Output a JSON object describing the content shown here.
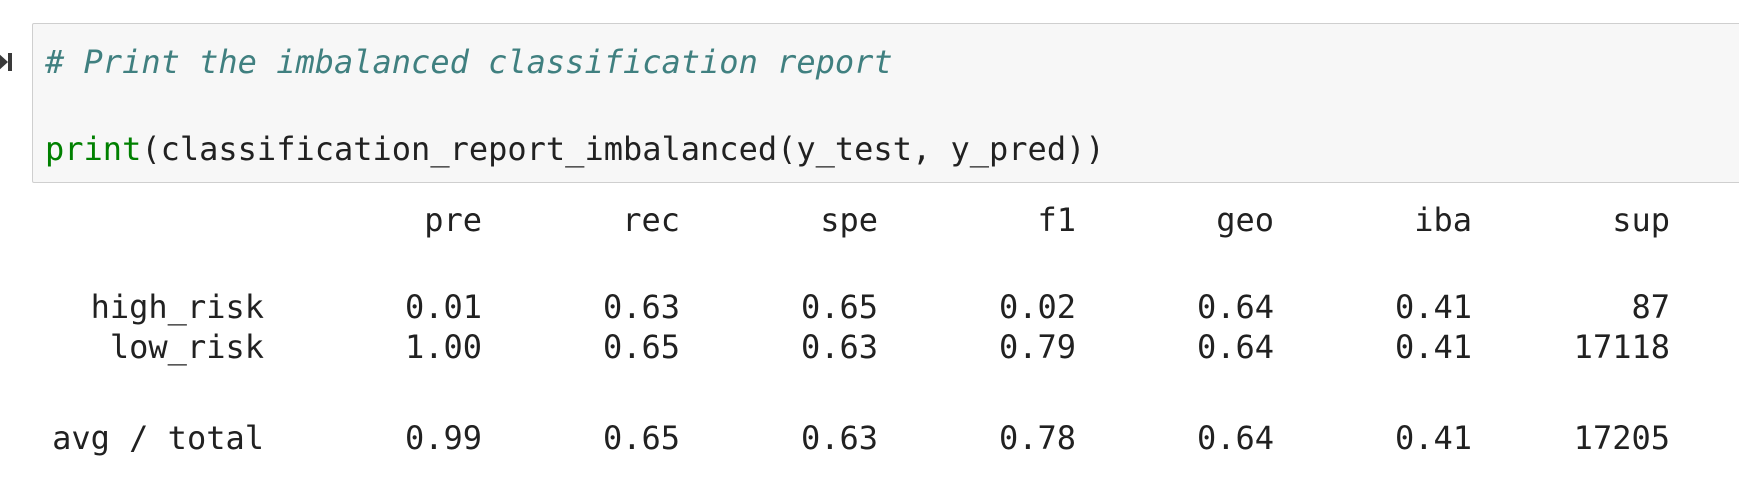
{
  "cell": {
    "comment": "# Print the imbalanced classification report",
    "code_builtin": "print",
    "code_rest": "(classification_report_imbalanced(y_test, y_pred))"
  },
  "output": {
    "headers": [
      "pre",
      "rec",
      "spe",
      "f1",
      "geo",
      "iba",
      "sup"
    ],
    "rows": [
      {
        "label": "high_risk",
        "values": [
          "0.01",
          "0.63",
          "0.65",
          "0.02",
          "0.64",
          "0.41",
          "87"
        ]
      },
      {
        "label": "low_risk",
        "values": [
          "1.00",
          "0.65",
          "0.63",
          "0.79",
          "0.64",
          "0.41",
          "17118"
        ]
      },
      {
        "label": "avg / total",
        "values": [
          "0.99",
          "0.65",
          "0.63",
          "0.78",
          "0.64",
          "0.41",
          "17205"
        ]
      }
    ]
  }
}
